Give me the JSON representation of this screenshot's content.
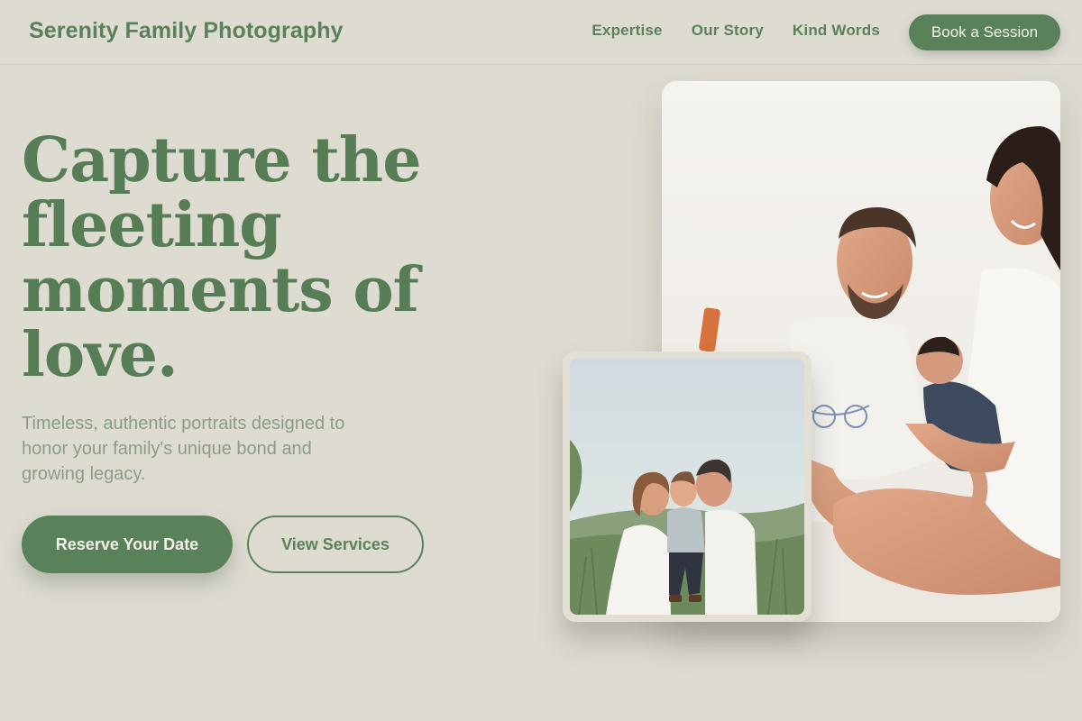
{
  "header": {
    "brand": "Serenity Family Photography",
    "nav": [
      "Expertise",
      "Our Story",
      "Kind Words"
    ],
    "cta": "Book a Session"
  },
  "hero": {
    "headline_lines": [
      "Capture the",
      "fleeting",
      "moments of",
      "love."
    ],
    "subtext_lines": [
      "Timeless, authentic portraits designed to",
      "honor your family's unique bond and",
      "growing legacy."
    ],
    "primary_button": "Reserve Your Date",
    "secondary_button": "View Services"
  },
  "images": {
    "main_photo": "family-bed-photo",
    "inset_photo": "family-outdoor-photo"
  },
  "colors": {
    "background": "#dedbd1",
    "accent": "#5a825a",
    "muted_text": "#8a9c87"
  }
}
